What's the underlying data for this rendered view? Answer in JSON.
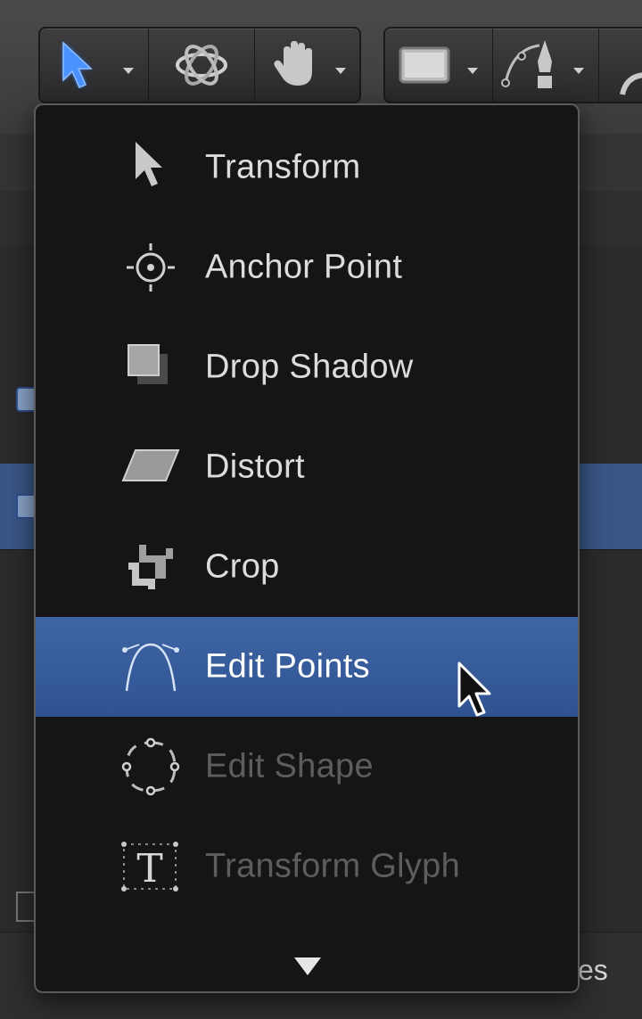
{
  "toolbar": {
    "group1": [
      {
        "icon": "select-arrow-icon",
        "has_dropdown": true,
        "active": true
      },
      {
        "icon": "3d-orbit-icon",
        "has_dropdown": false
      },
      {
        "icon": "pan-hand-icon",
        "has_dropdown": true
      }
    ],
    "group2": [
      {
        "icon": "rectangle-shape-icon",
        "has_dropdown": true
      },
      {
        "icon": "bezier-pen-icon",
        "has_dropdown": true
      }
    ]
  },
  "menu": {
    "items": [
      {
        "label": "Transform",
        "icon": "transform-arrow-icon",
        "state": "normal"
      },
      {
        "label": "Anchor Point",
        "icon": "anchor-point-icon",
        "state": "normal"
      },
      {
        "label": "Drop Shadow",
        "icon": "drop-shadow-icon",
        "state": "normal"
      },
      {
        "label": "Distort",
        "icon": "distort-icon",
        "state": "normal"
      },
      {
        "label": "Crop",
        "icon": "crop-icon",
        "state": "normal"
      },
      {
        "label": "Edit Points",
        "icon": "edit-points-icon",
        "state": "highlighted"
      },
      {
        "label": "Edit Shape",
        "icon": "edit-shape-icon",
        "state": "disabled"
      },
      {
        "label": "Transform Glyph",
        "icon": "transform-glyph-icon",
        "state": "disabled"
      }
    ],
    "scroll_indicator": "scroll-down-arrow-icon"
  },
  "background": {
    "bottom_text": "es"
  },
  "colors": {
    "highlight": "#2f5391",
    "menu_bg": "#151516",
    "accent_blue": "#3d8bff"
  }
}
